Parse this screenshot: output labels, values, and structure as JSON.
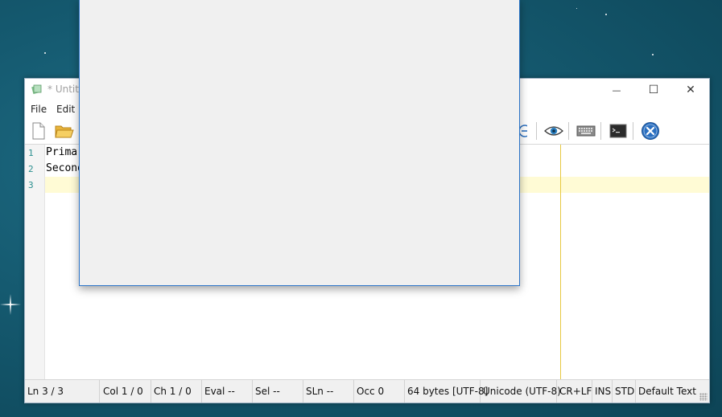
{
  "window": {
    "title": "* Untitl",
    "minimize_glyph": "—",
    "maximize_glyph": "☐",
    "close_glyph": "✕"
  },
  "menu": [
    "File",
    "Edit"
  ],
  "toolbar_icons": [
    "new-file-icon",
    "open-folder-icon",
    "zoom-out-icon",
    "view-icon",
    "keyboard-icon",
    "terminal-icon",
    "exit-icon"
  ],
  "editor": {
    "line_numbers": [
      "1",
      "2",
      "3"
    ],
    "lines": [
      "Primar",
      "Second",
      ""
    ],
    "current_line_color": "#fffbd5",
    "edge_color": "#e6c840"
  },
  "status": {
    "ln": "Ln 3 / 3",
    "col": "Col 1 / 0",
    "ch": "Ch 1 / 0",
    "eval": "Eval --",
    "sel": "Sel --",
    "sln": "SLn --",
    "occ": "Occ 0",
    "size": "64 bytes [UTF-8]",
    "encoding": "Unicode (UTF-8)",
    "eol": "CR+LF",
    "ins": "INS",
    "std": "STD",
    "lexer": "Default Text"
  },
  "dialog": {
    "border_color": "#2b74c8",
    "background": "#f0f0f0"
  },
  "desktop": {
    "background": "#155a70"
  }
}
